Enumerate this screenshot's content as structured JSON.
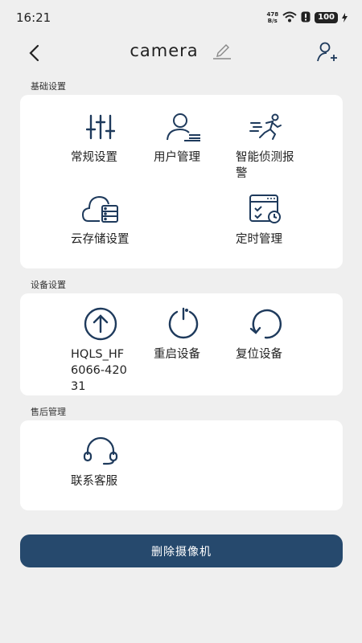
{
  "status": {
    "time": "16:21",
    "net_speed_top": "478",
    "net_speed_bottom": "B/s",
    "battery": "100"
  },
  "header": {
    "title": "camera"
  },
  "sections": {
    "basic": {
      "label": "基础设置",
      "items": [
        "常规设置",
        "用户管理",
        "智能侦测报警",
        "云存储设置",
        "定时管理"
      ]
    },
    "device": {
      "label": "设备设置",
      "items": [
        "HQLS_HF6066-42031",
        "重启设备",
        "复位设备"
      ]
    },
    "aftersale": {
      "label": "售后管理",
      "items": [
        "联系客服"
      ]
    }
  },
  "delete_button": "删除摄像机",
  "colors": {
    "accent": "#26496d",
    "icon": "#1e3a5c",
    "background": "#efefef"
  }
}
